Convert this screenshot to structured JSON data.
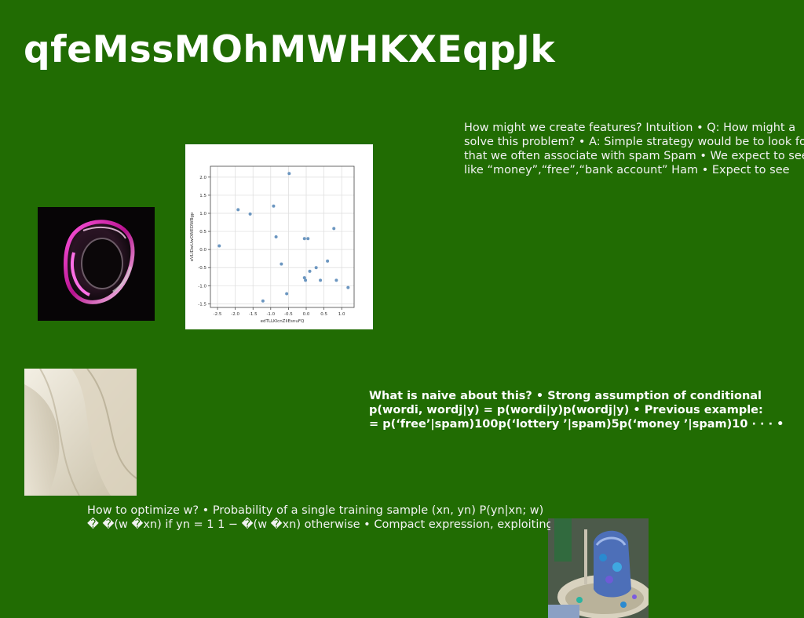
{
  "slide": {
    "title": "qfeMssMOhMWHKXEqpJk",
    "background_color": "#216c03"
  },
  "text_blocks": {
    "features": "How might we create features? Intuition • Q: How might a\nsolve this problem? • A: Simple strategy would be to look for\nthat we often associate with spam Spam • We expect to see\nlike “money”,“free”,“bank account” Ham • Expect to see",
    "naive": "What is naive about this? • Strong assumption of conditional\np(wordi, wordj|y) = p(wordi|y)p(wordj|y) • Previous example:\n= p(‘free’|spam)100p(‘lottery ’|spam)5p(‘money ’|spam)10 · · · •",
    "optimize": "How to optimize w? • Probability of a single training sample (xn, yn) P(yn|xn; w)\n� �(w �xn) if yn = 1 1 − �(w �xn) otherwise • Compact expression, exploiting"
  },
  "images": {
    "abstract_glass": {
      "alt": "abstract-glass-object"
    },
    "cream_waves": {
      "alt": "cream-abstract-waves"
    },
    "blue_vessel": {
      "alt": "blue-crystal-vessel"
    }
  },
  "chart_data": {
    "type": "scatter",
    "xlabel": "edTLLKlcnZliEsnuFQ",
    "ylabel": "oVLIDwUwOWEDWBgp",
    "xlim": [
      -2.7,
      1.35
    ],
    "ylim": [
      -1.6,
      2.3
    ],
    "xticks": [
      "-2.5",
      "-2.0",
      "-1.5",
      "-1.0",
      "-0.5",
      "0.0",
      "0.5",
      "1.0"
    ],
    "yticks": [
      "-1.5",
      "-1.0",
      "-0.5",
      "0.0",
      "0.5",
      "1.0",
      "1.5",
      "2.0"
    ],
    "grid": true,
    "point_color": "#6b96c0",
    "points": [
      {
        "x": -2.45,
        "y": 0.1
      },
      {
        "x": -1.92,
        "y": 1.1
      },
      {
        "x": -1.58,
        "y": 0.98
      },
      {
        "x": -1.22,
        "y": -1.42
      },
      {
        "x": -0.92,
        "y": 1.2
      },
      {
        "x": -0.85,
        "y": 0.35
      },
      {
        "x": -0.7,
        "y": -0.4
      },
      {
        "x": -0.55,
        "y": -1.22
      },
      {
        "x": -0.48,
        "y": 2.1
      },
      {
        "x": -0.05,
        "y": 0.3
      },
      {
        "x": 0.05,
        "y": 0.3
      },
      {
        "x": -0.05,
        "y": -0.78
      },
      {
        "x": -0.02,
        "y": -0.85
      },
      {
        "x": 0.1,
        "y": -0.6
      },
      {
        "x": 0.28,
        "y": -0.5
      },
      {
        "x": 0.4,
        "y": -0.85
      },
      {
        "x": 0.6,
        "y": -0.32
      },
      {
        "x": 0.78,
        "y": 0.58
      },
      {
        "x": 0.85,
        "y": -0.85
      },
      {
        "x": 1.18,
        "y": -1.05
      }
    ]
  }
}
